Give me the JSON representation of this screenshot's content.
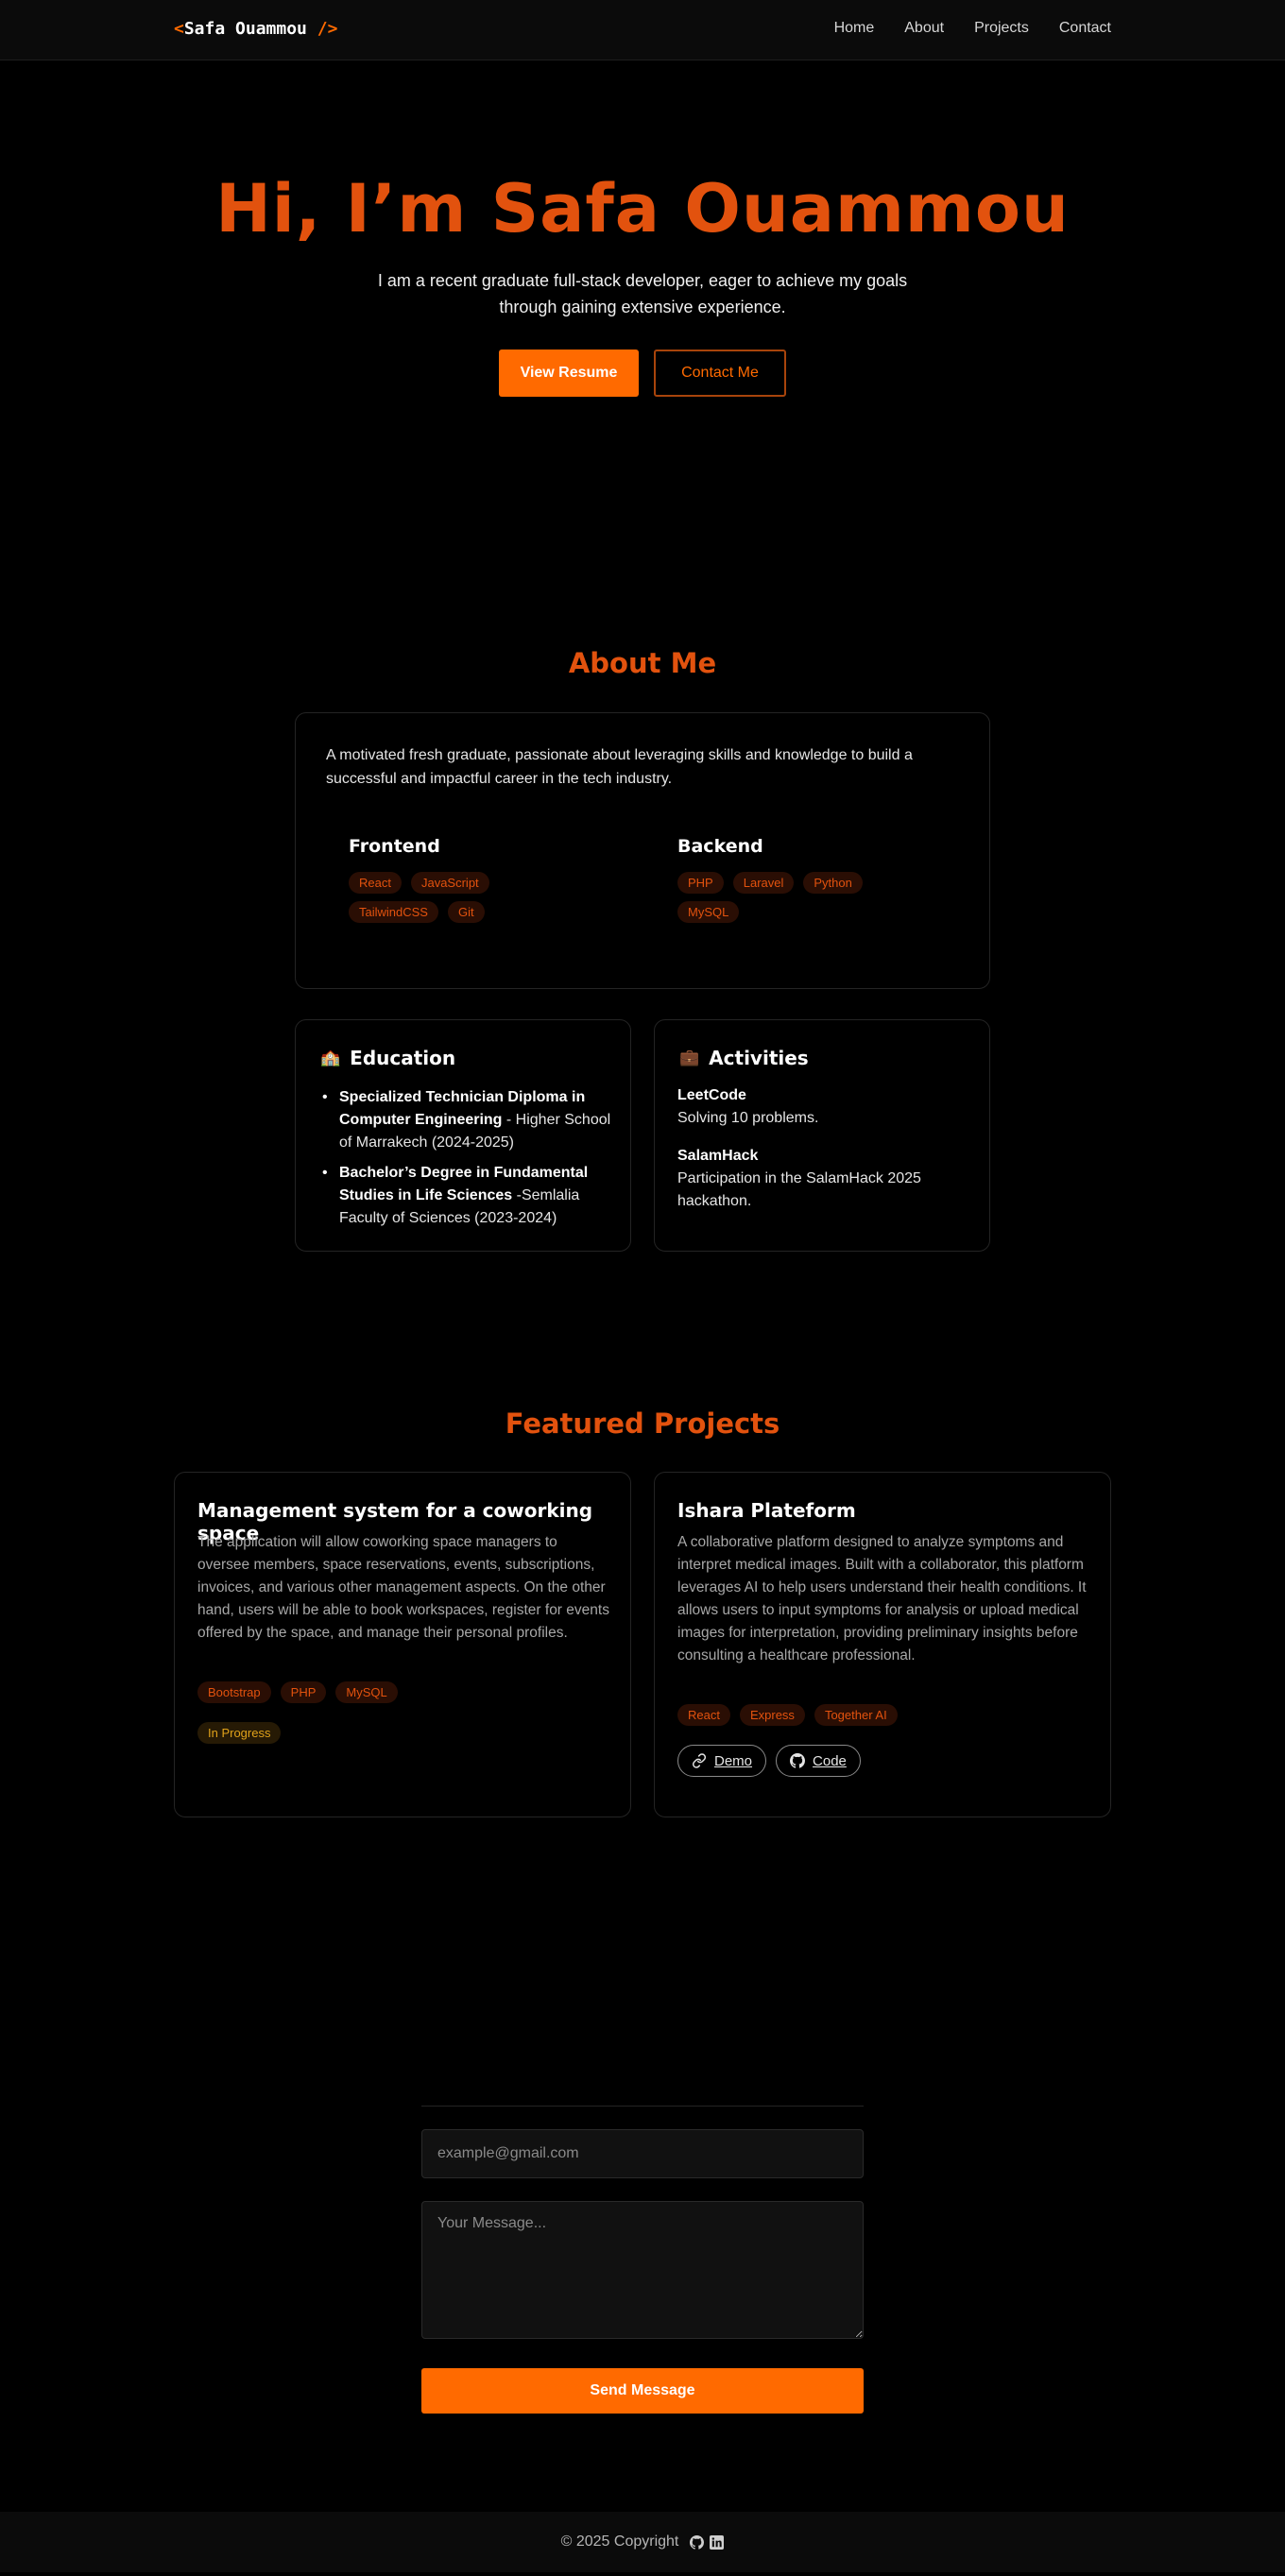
{
  "nav": {
    "logo_open": "<",
    "logo_name": "Safa Ouammou",
    "logo_close": "/>",
    "links": [
      "Home",
      "About",
      "Projects",
      "Contact"
    ]
  },
  "hero": {
    "title": "Hi, I’m Safa Ouammou",
    "subtitle": "I am a recent graduate full-stack developer, eager to achieve my goals through gaining extensive experience.",
    "primary_button": "View Resume",
    "secondary_button": "Contact Me"
  },
  "about": {
    "title": "About Me",
    "intro": "A motivated fresh graduate, passionate about leveraging skills and knowledge to build a successful and impactful career in the tech industry.",
    "frontend": {
      "title": "Frontend",
      "skills": [
        "React",
        "JavaScript",
        "TailwindCSS",
        "Git"
      ]
    },
    "backend": {
      "title": "Backend",
      "skills": [
        "PHP",
        "Laravel",
        "Python",
        "MySQL"
      ]
    }
  },
  "education": {
    "emoji": "🏫",
    "title": "Education",
    "items": [
      {
        "degree": "Specialized Technician Diploma in Computer Engineering",
        "detail": " - Higher School of Marrakech (2024-2025)"
      },
      {
        "degree": "Bachelor’s Degree in Fundamental Studies in Life Sciences",
        "detail": " -Semlalia Faculty of Sciences (2023-2024)"
      }
    ]
  },
  "activities": {
    "emoji": "💼",
    "title": "Activities",
    "items": [
      {
        "name": "LeetCode",
        "desc": "Solving 10 problems."
      },
      {
        "name": "SalamHack",
        "desc": "Participation in the SalamHack 2025 hackathon."
      }
    ]
  },
  "projects": {
    "title": "Featured Projects",
    "items": [
      {
        "title": "Management system for a coworking space",
        "desc": "The application will allow coworking space managers to oversee members, space reservations, events, subscriptions, invoices, and various other management aspects. On the other hand, users will be able to book workspaces, register for events offered by the space, and manage their personal profiles.",
        "tags": [
          "Bootstrap",
          "PHP",
          "MySQL"
        ],
        "status": "In Progress"
      },
      {
        "title": "Ishara Plateform",
        "desc": "A collaborative platform designed to analyze symptoms and interpret medical images. Built with a collaborator, this platform leverages AI to help users understand their health conditions. It allows users to input symptoms for analysis or upload medical images for interpretation, providing preliminary insights before consulting a healthcare professional.",
        "tags": [
          "React",
          "Express",
          "Together AI"
        ],
        "demo_label": "Demo",
        "code_label": "Code"
      }
    ]
  },
  "contact": {
    "email_placeholder": "example@gmail.com",
    "message_placeholder": "Your Message...",
    "send_label": "Send Message"
  },
  "footer": {
    "copyright": "© 2025 Copyright"
  },
  "icons": {
    "link": "link-icon",
    "github": "github-icon",
    "linkedin": "linkedin-icon"
  },
  "colors": {
    "accent": "#ff6a00",
    "heading": "#e2520e",
    "background": "#000000"
  }
}
